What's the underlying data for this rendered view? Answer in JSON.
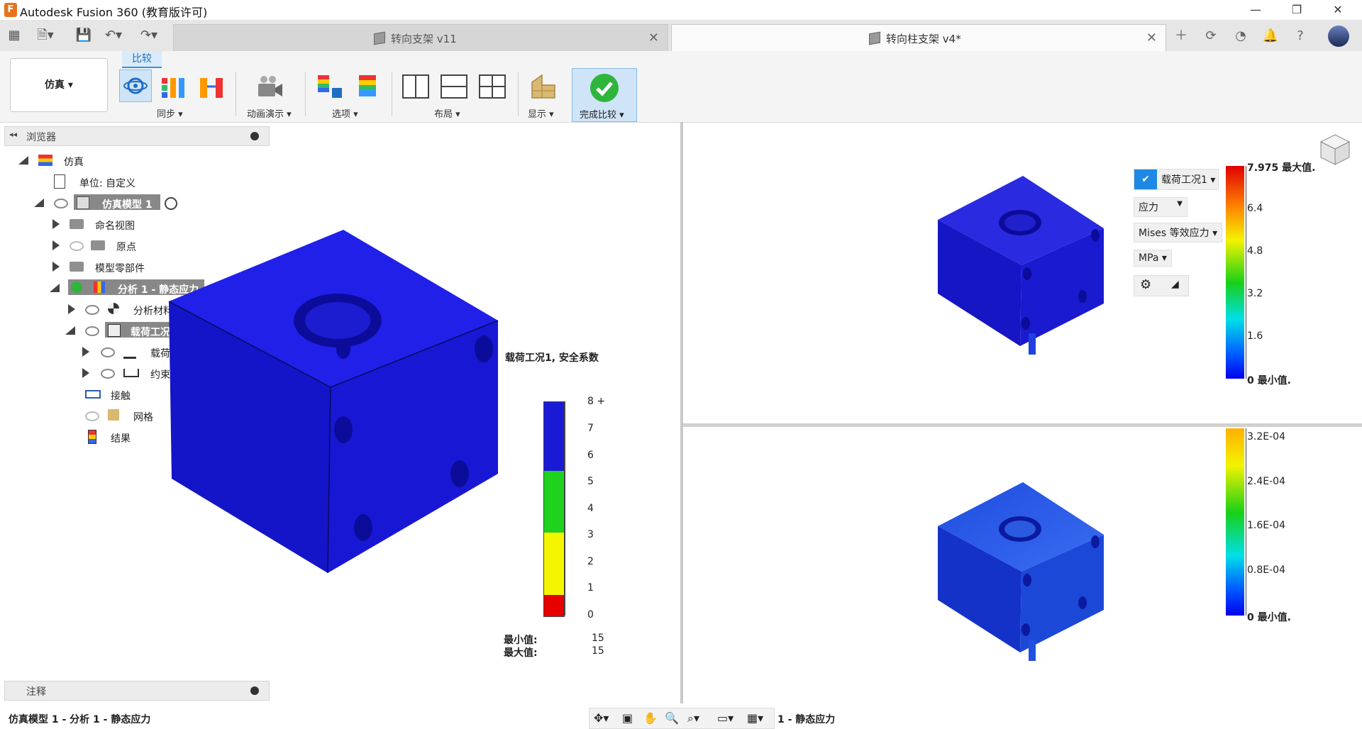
{
  "app": {
    "title": "Autodesk Fusion 360 (教育版许可)",
    "logo_letter": "F"
  },
  "window_controls": {
    "minimize": "—",
    "maximize": "❐",
    "close": "✕"
  },
  "tabs": [
    {
      "label": "转向支架 v11",
      "active": false
    },
    {
      "label": "转向柱支架 v4*",
      "active": true
    }
  ],
  "ribbon": {
    "workspace": "仿真 ▾",
    "active_tab": "比较",
    "groups": {
      "sync": "同步 ▾",
      "animate": "动画演示 ▾",
      "options": "选项 ▾",
      "layout": "布局 ▾",
      "display": "显示 ▾",
      "finish": "完成比较 ▾"
    }
  },
  "browser": {
    "header": "浏览器",
    "items": [
      {
        "label": "仿真"
      },
      {
        "label": "单位: 自定义"
      },
      {
        "label": "仿真模型 1"
      },
      {
        "label": "命名视图"
      },
      {
        "label": "原点"
      },
      {
        "label": "模型零部件"
      },
      {
        "label": "分析 1 - 静态应力"
      },
      {
        "label": "分析材料"
      },
      {
        "label": "载荷工况1"
      },
      {
        "label": "载荷"
      },
      {
        "label": "约束"
      },
      {
        "label": "接触"
      },
      {
        "label": "网格"
      },
      {
        "label": "结果"
      }
    ]
  },
  "comments": {
    "header": "注释"
  },
  "left_view": {
    "result_title": "载荷工况1, 安全系数",
    "legend": [
      "8 +",
      "7",
      "6",
      "5",
      "4",
      "3",
      "2",
      "1",
      "0"
    ],
    "min_label": "最小值:",
    "min_value": "15",
    "max_label": "最大值:",
    "max_value": "15"
  },
  "right_top": {
    "load_case": "载荷工况1 ▾",
    "result_type": "应力",
    "component": "Mises 等效应力 ▾",
    "unit": "MPa ▾",
    "legend": [
      "7.975 最大值.",
      "6.4",
      "4.8",
      "3.2",
      "1.6",
      "0 最小值."
    ]
  },
  "right_bottom": {
    "legend": [
      "3.2E-04",
      "2.4E-04",
      "1.6E-04",
      "0.8E-04",
      "0 最小值."
    ]
  },
  "status": {
    "left": "仿真模型 1 - 分析 1 - 静态应力",
    "right": "1 - 静态应力"
  },
  "colors": {
    "model_blue": "#1a1ad6",
    "safety_red": "#e60000",
    "safety_yellow": "#f5f500",
    "safety_green": "#1ed21e",
    "accent": "#3a8fd6"
  }
}
